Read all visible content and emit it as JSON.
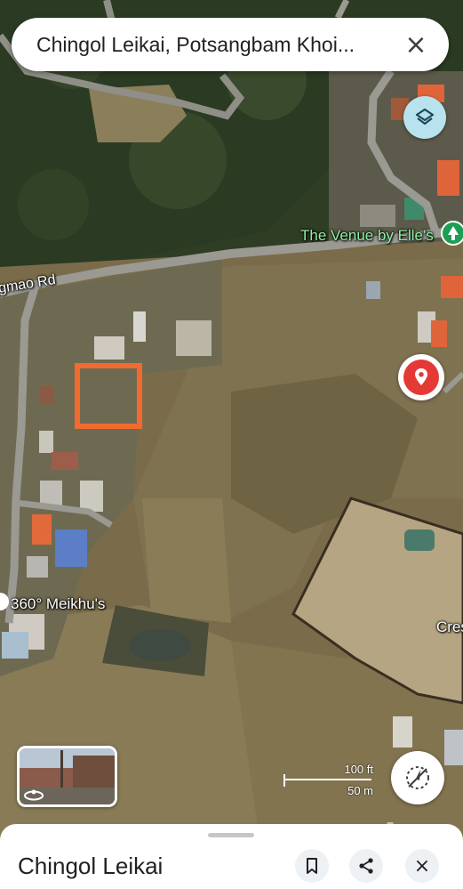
{
  "search": {
    "query": "Chingol Leikai, Potsangbam Khoi...",
    "close_icon": "×"
  },
  "map": {
    "labels": {
      "venue": "The Venue by Elle's",
      "road": "gmao Rd",
      "meikhu": "360° Meikhu's",
      "cres": "Cres"
    },
    "highlight_color": "#f26a2e",
    "pin_color": "#e53935"
  },
  "scale": {
    "feet": "100 ft",
    "meters": "50 m"
  },
  "sheet": {
    "title": "Chingol Leikai",
    "close_icon": "×"
  },
  "icons": {
    "layers": "layers-icon",
    "pin": "location-pin-icon",
    "compass": "compass-icon",
    "save": "bookmark-icon",
    "share": "share-icon",
    "streetview": "streetview-360-icon"
  }
}
